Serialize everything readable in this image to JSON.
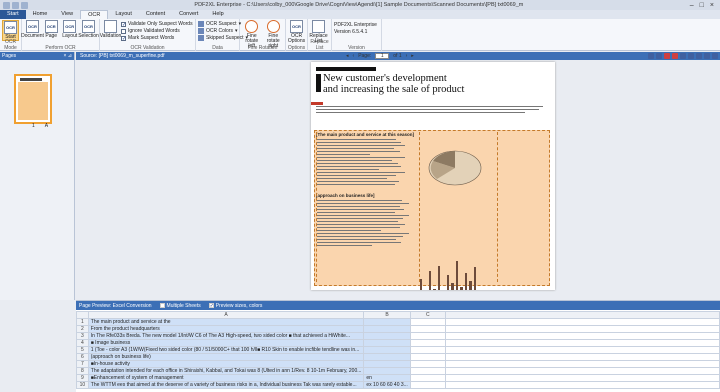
{
  "window": {
    "title": "PDF2XL Enterprise - C:\\Users\\colby_000\\Google Drive\\CogniView\\Agendi\\[1] Sample Documents\\Scanned Documents\\[PB] txt0069_m"
  },
  "tabs": [
    "Start",
    "Home",
    "View",
    "OCR",
    "Layout",
    "Content",
    "Convert",
    "Help"
  ],
  "ribbon": {
    "groups": {
      "perform_ocr": "OCR Mode",
      "perform_ocr2": "Perform OCR",
      "validation": "OCR Validation",
      "data": "Data",
      "rotation": "Fine Rotation",
      "options": "Options",
      "replace": "Replace List",
      "version": "Version"
    },
    "buttons": {
      "start": "Start",
      "document": "Document",
      "page": "Page",
      "layout": "Layout",
      "selection": "Selection",
      "validation": "Validation",
      "rotate_left": "Fine rotate left",
      "rotate_right": "Fine rotate right",
      "ocr_options": "OCR Options",
      "replace_list": "Replace List"
    },
    "checks": [
      {
        "label": "Validate Only Suspect Words",
        "checked": true
      },
      {
        "label": "Ignore Validated Words",
        "checked": false
      },
      {
        "label": "Mark Suspect Words",
        "checked": true
      }
    ],
    "combos": [
      "OCR Suspect",
      "OCR Colors",
      "Skipped Suspect"
    ],
    "version": [
      "PDF2XL Enterprise",
      "Version 6.5.4.1"
    ]
  },
  "pages_panel": {
    "title": "Pages",
    "thumb_labels": [
      "1",
      "A"
    ]
  },
  "doc_tab": {
    "title": "Source: [PB] txt0069_m_superfine.pdf"
  },
  "nav": {
    "page_label": "Page:",
    "page_value": "1",
    "of_label": "of 1"
  },
  "page": {
    "title_line1": "New customer's development",
    "title_line2": "and increasing the sale of product",
    "sections": [
      "[The main product and service at this season]",
      "[approach on business life]"
    ]
  },
  "conversion": {
    "title": "Page Preview: Excel Conversion",
    "options": [
      {
        "label": "Multiple Sheets",
        "checked": false
      },
      {
        "label": "Preview sizes, colors",
        "checked": true
      }
    ],
    "columns": [
      "A",
      "B",
      "C"
    ],
    "rows": [
      [
        "The main product and service at the",
        "",
        ""
      ],
      [
        "From the product headquarters",
        "",
        ""
      ],
      [
        "In The Rfe033s Breda. The new model 1/Int/W C6 of The A3 High-speed, two sided color ■ that achieved a HiWhite...",
        "",
        ""
      ],
      [
        "■ Image business",
        "",
        ""
      ],
      [
        "1 (Toe - color A3 (1W/W(Fixed two sided color (80 / 51/5000C+ that 100 h/ll■ R10 Skin to enable incfible tendline was in...",
        "",
        ""
      ],
      [
        "(approach on business life)",
        "",
        ""
      ],
      [
        "■In-house activity",
        "",
        ""
      ],
      [
        "The adaptation intended for each office in Shiraishi, Kabbal, and Tokai was 8 (Ulted in ann 1/Rev. 8 10-1m February, 200...",
        "",
        ""
      ],
      [
        "■Enhancement of system of management",
        "en",
        ""
      ],
      [
        "The WTTM ees that aimed at the deserve of a variety of business risks in a, Individual business Tak was rarely estable...",
        "ex 10 60 60 40 3...",
        ""
      ]
    ]
  }
}
